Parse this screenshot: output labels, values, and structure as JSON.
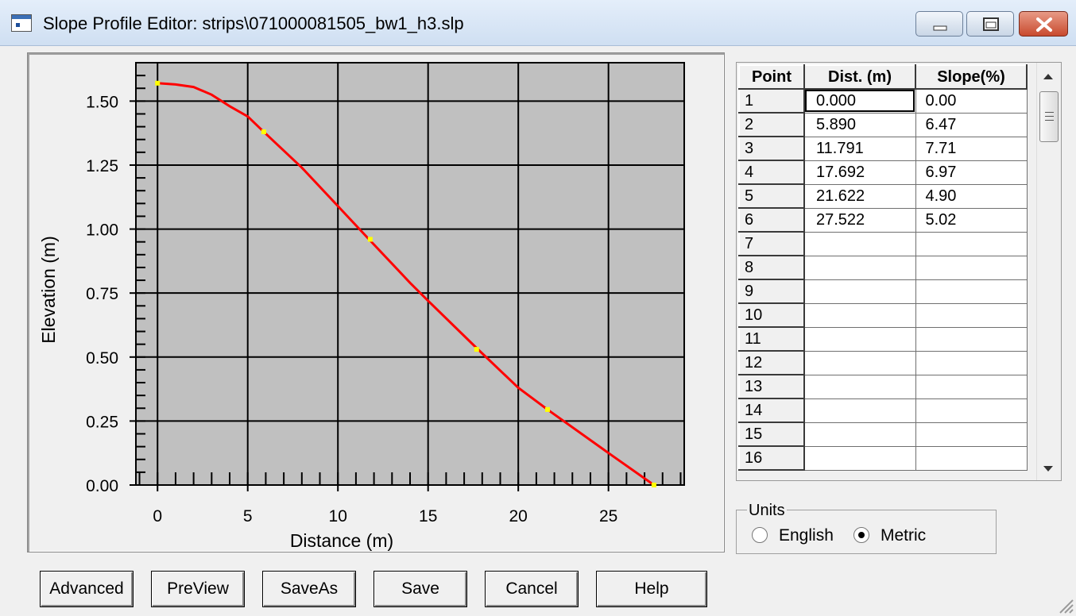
{
  "window": {
    "title": "Slope Profile Editor: strips\\071000081505_bw1_h3.slp"
  },
  "chart_data": {
    "type": "line",
    "xlabel": "Distance (m)",
    "ylabel": "Elevation (m)",
    "xlim": [
      -1.2,
      29.2
    ],
    "ylim": [
      0,
      1.65
    ],
    "x_ticks": [
      0,
      5,
      10,
      15,
      20,
      25
    ],
    "y_ticks": [
      0.0,
      0.25,
      0.5,
      0.75,
      1.0,
      1.25,
      1.5
    ],
    "x_tick_labels": [
      "0",
      "5",
      "10",
      "15",
      "20",
      "25"
    ],
    "y_tick_labels": [
      "0.00",
      "0.25",
      "0.50",
      "0.75",
      "1.00",
      "1.25",
      "1.50"
    ],
    "grid": true,
    "colors": {
      "plot_bg": "#c0c0c0",
      "line": "#ff0000",
      "points": "#ffff00"
    },
    "series": [
      {
        "x": [
          0,
          1,
          2,
          3,
          4,
          5,
          5.89,
          8,
          10,
          11.791,
          14,
          15,
          17.692,
          20,
          21.622,
          25,
          27.522
        ],
        "y": [
          1.57,
          1.565,
          1.555,
          1.525,
          1.48,
          1.44,
          1.38,
          1.24,
          1.09,
          0.955,
          0.79,
          0.72,
          0.535,
          0.38,
          0.295,
          0.125,
          0.0
        ]
      }
    ],
    "control_points": {
      "x": [
        0.0,
        5.89,
        11.791,
        17.692,
        21.622,
        27.522
      ],
      "y": [
        1.57,
        1.38,
        0.96,
        0.53,
        0.295,
        0.0
      ]
    }
  },
  "table": {
    "headers": [
      "Point",
      "Dist. (m)",
      "Slope(%)"
    ],
    "rows": [
      {
        "point": "1",
        "dist": "0.000",
        "slope": "0.00"
      },
      {
        "point": "2",
        "dist": "5.890",
        "slope": "6.47"
      },
      {
        "point": "3",
        "dist": "11.791",
        "slope": "7.71"
      },
      {
        "point": "4",
        "dist": "17.692",
        "slope": "6.97"
      },
      {
        "point": "5",
        "dist": "21.622",
        "slope": "4.90"
      },
      {
        "point": "6",
        "dist": "27.522",
        "slope": "5.02"
      },
      {
        "point": "7",
        "dist": "",
        "slope": ""
      },
      {
        "point": "8",
        "dist": "",
        "slope": ""
      },
      {
        "point": "9",
        "dist": "",
        "slope": ""
      },
      {
        "point": "10",
        "dist": "",
        "slope": ""
      },
      {
        "point": "11",
        "dist": "",
        "slope": ""
      },
      {
        "point": "12",
        "dist": "",
        "slope": ""
      },
      {
        "point": "13",
        "dist": "",
        "slope": ""
      },
      {
        "point": "14",
        "dist": "",
        "slope": ""
      },
      {
        "point": "15",
        "dist": "",
        "slope": ""
      },
      {
        "point": "16",
        "dist": "",
        "slope": ""
      }
    ]
  },
  "units": {
    "group_label": "Units",
    "options": [
      "English",
      "Metric"
    ],
    "selected": "Metric"
  },
  "buttons": {
    "advanced": "Advanced",
    "preview": "PreView",
    "saveas": "SaveAs",
    "save": "Save",
    "cancel": "Cancel",
    "help": "Help"
  }
}
